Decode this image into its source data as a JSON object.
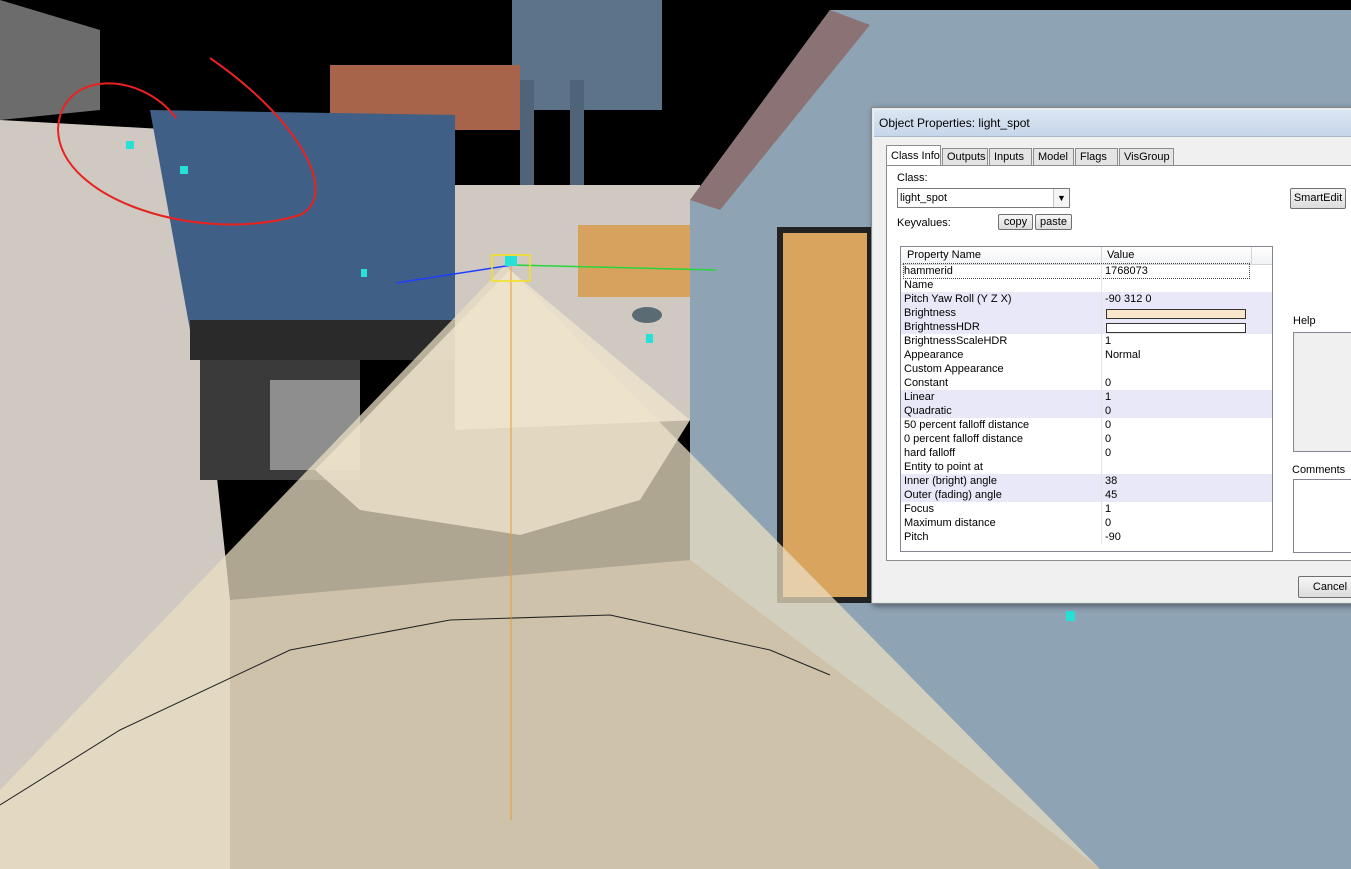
{
  "colors": {
    "sky": "#000000",
    "concrete": "#cfc9c1",
    "silo": "#5d7389",
    "tank_blue": "#3f5f86",
    "cone": "#e9ddc2",
    "building_blue": "#8ea3b4",
    "annotation_red": "#e8221f",
    "light_cyan": "#27e0d8",
    "brightness_swatch": "#fae7cb",
    "brightness_hdr_swatch": "#ffffff",
    "alt_row": "#e8e8f8"
  },
  "viewport": {
    "annotation": "red-circle-around-lights"
  },
  "dialog": {
    "title": "Object Properties: light_spot",
    "tabs": [
      {
        "label": "Class Info",
        "active": true
      },
      {
        "label": "Outputs",
        "active": false
      },
      {
        "label": "Inputs",
        "active": false
      },
      {
        "label": "Model",
        "active": false
      },
      {
        "label": "Flags",
        "active": false
      },
      {
        "label": "VisGroup",
        "active": false
      }
    ],
    "class_label": "Class:",
    "class_value": "light_spot",
    "keyvalues_label": "Keyvalues:",
    "copy_label": "copy",
    "paste_label": "paste",
    "smartedit_label": "SmartEdit",
    "help_label": "Help",
    "comments_label": "Comments",
    "cancel_label": "Cancel",
    "columns": {
      "name": "Property Name",
      "value": "Value"
    },
    "properties": [
      {
        "name": "hammerid",
        "value": "1768073"
      },
      {
        "name": "Name",
        "value": ""
      },
      {
        "name": "Pitch Yaw Roll (Y Z X)",
        "value": "-90 312 0"
      },
      {
        "name": "Brightness",
        "value": ""
      },
      {
        "name": "BrightnessHDR",
        "value": ""
      },
      {
        "name": "BrightnessScaleHDR",
        "value": "1"
      },
      {
        "name": "Appearance",
        "value": "Normal"
      },
      {
        "name": "Custom Appearance",
        "value": ""
      },
      {
        "name": "Constant",
        "value": "0"
      },
      {
        "name": "Linear",
        "value": "1"
      },
      {
        "name": "Quadratic",
        "value": "0"
      },
      {
        "name": "50 percent falloff distance",
        "value": "0"
      },
      {
        "name": "0 percent falloff distance",
        "value": "0"
      },
      {
        "name": "hard falloff",
        "value": "0"
      },
      {
        "name": "Entity to point at",
        "value": ""
      },
      {
        "name": "Inner (bright) angle",
        "value": "38"
      },
      {
        "name": "Outer (fading) angle",
        "value": "45"
      },
      {
        "name": "Focus",
        "value": "1"
      },
      {
        "name": "Maximum distance",
        "value": "0"
      },
      {
        "name": "Pitch",
        "value": "-90"
      }
    ]
  }
}
